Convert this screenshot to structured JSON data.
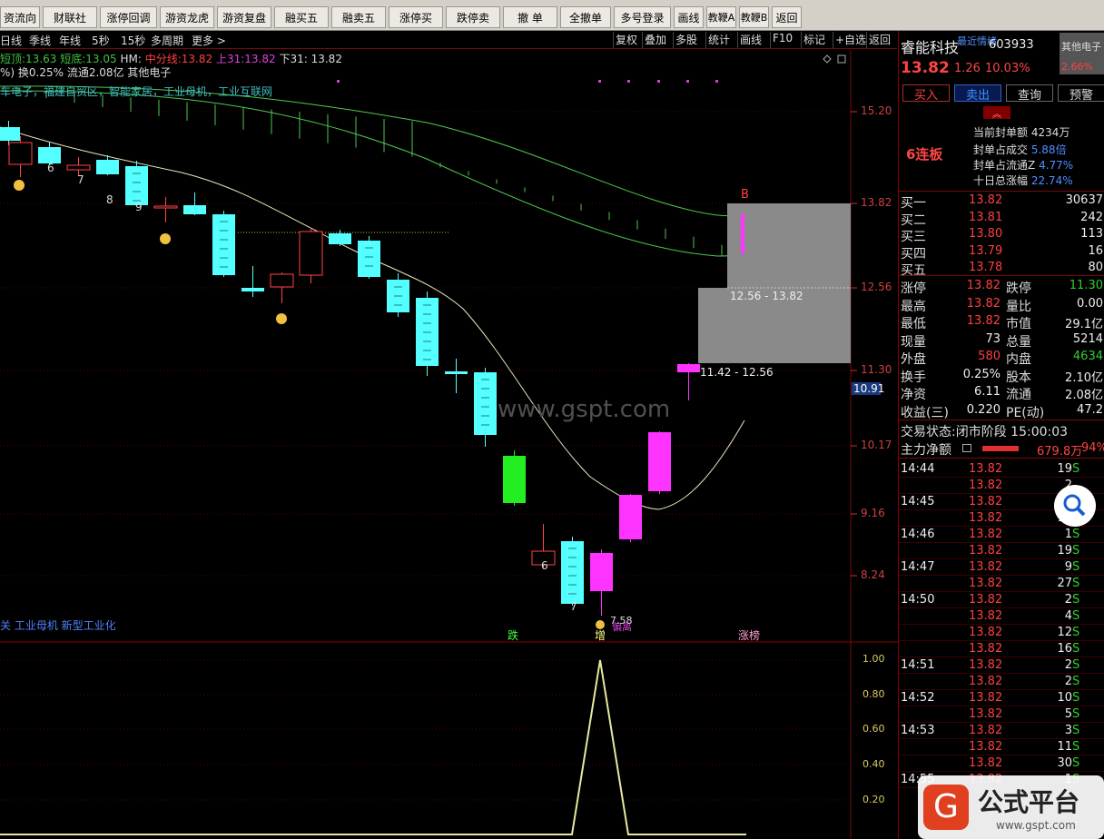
{
  "toolbar": {
    "buttons": [
      "资流向",
      "财联社",
      "涨停回调",
      "游资龙虎",
      "游资复盘",
      "融买五",
      "融卖五",
      "涨停买",
      "跌停卖",
      "撤 单",
      "全撤单",
      "多号登录",
      "画线",
      "教鞭A",
      "教鞭B",
      "返回"
    ]
  },
  "nav": {
    "periods": [
      "日线",
      "季线",
      "年线",
      "5秒",
      "15秒",
      "多周期",
      "更多 >"
    ],
    "tools": [
      "复权",
      "叠加",
      "多股",
      "统计",
      "画线",
      "F10",
      "标记",
      "+自选",
      "返回"
    ]
  },
  "info": {
    "top_label": "短顶:",
    "top_val": "13.63",
    "bot_label": "短底:",
    "bot_val": "13.05",
    "hm": "HM:",
    "mid_label": "中分线:",
    "mid_val": "13.82",
    "up_label": "上31:",
    "up_val": "13.82",
    "down": "下31: 13.82",
    "line2": "%) 换0.25% 流通2.08亿 其他电子",
    "concepts": "车电子，福建自贸区，智能家居，工业母机，工业互联网",
    "concepts_bottom": "关 工业母机 新型工业化"
  },
  "markers": {
    "b": "B",
    "diaolabel": "跌",
    "zeng": "增",
    "jiaolabel": "偏离",
    "zhangbang": "涨榜",
    "low_label": "7.58",
    "gray_upper": "12.56 - 13.82",
    "gray_lower": "11.42 - 12.56",
    "watermark": "www.gspt.com",
    "n6": "6",
    "n7": "7",
    "n8": "8",
    "n9": "9",
    "n6b": "6",
    "n7b": "7"
  },
  "yaxis": {
    "labels": [
      "15.20",
      "13.82",
      "12.56",
      "11.30",
      "10.17",
      "9.16",
      "8.24"
    ],
    "current": "10.91"
  },
  "oscillator": {
    "labels": [
      "1.00",
      "0.80",
      "0.60",
      "0.40",
      "0.20"
    ]
  },
  "stock": {
    "name": "睿能科技",
    "tag": "最近情绪",
    "code": "603933",
    "sector": "其他电子",
    "price": "13.82",
    "change": "1.26",
    "pct": "10.03%",
    "sector_pct": "2.66%"
  },
  "actions": {
    "buy": "买入",
    "sell": "卖出",
    "query": "查询",
    "alert": "预警"
  },
  "seal": {
    "amount_label": "当前封单额",
    "amount": "4234万",
    "ratio_label": "封单占成交",
    "ratio": "5.88倍",
    "float_label": "封单占流通Z",
    "float": "4.77%",
    "tenday_label": "十日总涨幅",
    "tenday": "22.74%",
    "streak": "6连板"
  },
  "bids": [
    {
      "l": "买一",
      "p": "13.82",
      "v": "30637"
    },
    {
      "l": "买二",
      "p": "13.81",
      "v": "242"
    },
    {
      "l": "买三",
      "p": "13.80",
      "v": "113"
    },
    {
      "l": "买四",
      "p": "13.79",
      "v": "16"
    },
    {
      "l": "买五",
      "p": "13.78",
      "v": "80"
    }
  ],
  "stats": [
    {
      "a": "涨停",
      "av": "13.82",
      "b": "跌停",
      "bv": "11.30"
    },
    {
      "a": "最高",
      "av": "13.82",
      "b": "量比",
      "bv": "0.00"
    },
    {
      "a": "最低",
      "av": "13.82",
      "b": "市值",
      "bv": "29.1亿"
    },
    {
      "a": "现量",
      "av": "73",
      "b": "总量",
      "bv": "5214"
    },
    {
      "a": "外盘",
      "av": "580",
      "b": "内盘",
      "bv": "4634"
    },
    {
      "a": "换手",
      "av": "0.25%",
      "b": "股本",
      "bv": "2.10亿"
    },
    {
      "a": "净资",
      "av": "6.11",
      "b": "流通",
      "bv": "2.08亿"
    },
    {
      "a": "收益(三)",
      "av": "0.220",
      "b": "PE(动)",
      "bv": "47.2"
    }
  ],
  "status": {
    "label": "交易状态:",
    "text": "闭市阶段 15:00:03"
  },
  "flow": {
    "label": "主力净额",
    "value": "679.8万",
    "pct": "94%"
  },
  "ticks": [
    {
      "t": "14:44",
      "p": "13.82",
      "v": "19",
      "s": "S"
    },
    {
      "t": "",
      "p": "13.82",
      "v": "2",
      "s": ""
    },
    {
      "t": "14:45",
      "p": "13.82",
      "v": "10",
      "s": ""
    },
    {
      "t": "",
      "p": "13.82",
      "v": "13",
      "s": ""
    },
    {
      "t": "14:46",
      "p": "13.82",
      "v": "1",
      "s": "S"
    },
    {
      "t": "",
      "p": "13.82",
      "v": "19",
      "s": "S"
    },
    {
      "t": "14:47",
      "p": "13.82",
      "v": "9",
      "s": "S"
    },
    {
      "t": "",
      "p": "13.82",
      "v": "27",
      "s": "S"
    },
    {
      "t": "14:50",
      "p": "13.82",
      "v": "2",
      "s": "S"
    },
    {
      "t": "",
      "p": "13.82",
      "v": "4",
      "s": "S"
    },
    {
      "t": "",
      "p": "13.82",
      "v": "12",
      "s": "S"
    },
    {
      "t": "",
      "p": "13.82",
      "v": "16",
      "s": "S"
    },
    {
      "t": "14:51",
      "p": "13.82",
      "v": "2",
      "s": "S"
    },
    {
      "t": "",
      "p": "13.82",
      "v": "2",
      "s": "S"
    },
    {
      "t": "14:52",
      "p": "13.82",
      "v": "10",
      "s": "S"
    },
    {
      "t": "",
      "p": "13.82",
      "v": "5",
      "s": "S"
    },
    {
      "t": "14:53",
      "p": "13.82",
      "v": "3",
      "s": "S"
    },
    {
      "t": "",
      "p": "13.82",
      "v": "11",
      "s": "S"
    },
    {
      "t": "",
      "p": "13.82",
      "v": "30",
      "s": "S"
    },
    {
      "t": "14:55",
      "p": "13.82",
      "v": "1",
      "s": "S"
    }
  ],
  "logo": {
    "text": "公式平台",
    "url": "www.gspt.com"
  },
  "colors": {
    "up": "#ff4444",
    "down": "#2fd02f",
    "cyan": "#54ffff",
    "magenta": "#ff33ff",
    "grid": "#7a0a0a"
  }
}
